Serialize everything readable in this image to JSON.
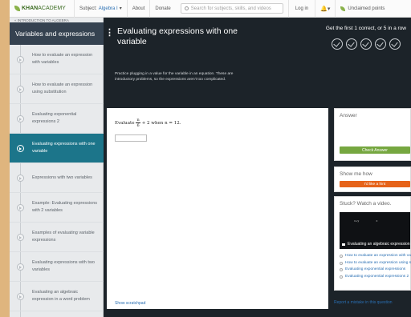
{
  "topbar": {
    "logo_bold": "KHAN",
    "logo_rest": "ACADEMY",
    "subject_label": "Subject:",
    "subject_value": "Algebra I",
    "about": "About",
    "donate": "Donate",
    "search_placeholder": "Search for subjects, skills, and videos",
    "login": "Log in",
    "points": "Unclaimed points"
  },
  "sidebar": {
    "breadcrumb": "« INTRODUCTION TO ALGEBRA",
    "title": "Variables and expressions",
    "items": [
      {
        "label": "How to evaluate an expression with variables"
      },
      {
        "label": "How to evaluate an expression using substitution"
      },
      {
        "label": "Evaluating exponential expressions 2"
      },
      {
        "label": "Evaluating expressions with one variable"
      },
      {
        "label": "Expressions with two variables"
      },
      {
        "label": "Example: Evaluating expressions with 2 variables"
      },
      {
        "label": "Examples of evaluating variable expressions"
      },
      {
        "label": "Evaluating expressions with two variables"
      },
      {
        "label": "Evaluating an algebraic expression in a word problem"
      }
    ]
  },
  "hero": {
    "title": "Evaluating expressions with one variable",
    "description": "Practice plugging in a value for the variable in an equation. These are introductory problems, so the expressions aren't too complicated.",
    "goal": "Get the first 1 correct, or 5 in a row"
  },
  "problem": {
    "prefix": "Evaluate",
    "numerator": "n",
    "denominator": "6",
    "suffix": "+ 2 when n = 12.",
    "scratchpad": "Show scratchpad"
  },
  "answer_panel": {
    "title": "Answer",
    "check_button": "Check Answer"
  },
  "hint_panel": {
    "title": "Show me how",
    "hint_button": "I'd like a hint"
  },
  "video_panel": {
    "title": "Stuck? Watch a video.",
    "video_caption": "Evaluating an algebraic expression",
    "links": [
      {
        "label": "How to evaluate an expression with variables"
      },
      {
        "label": "How to evaluate an expression using substitution"
      },
      {
        "label": "Evaluating exponential expressions"
      },
      {
        "label": "Evaluating exponential expressions 2"
      }
    ]
  },
  "report": "Report a mistake in this question"
}
